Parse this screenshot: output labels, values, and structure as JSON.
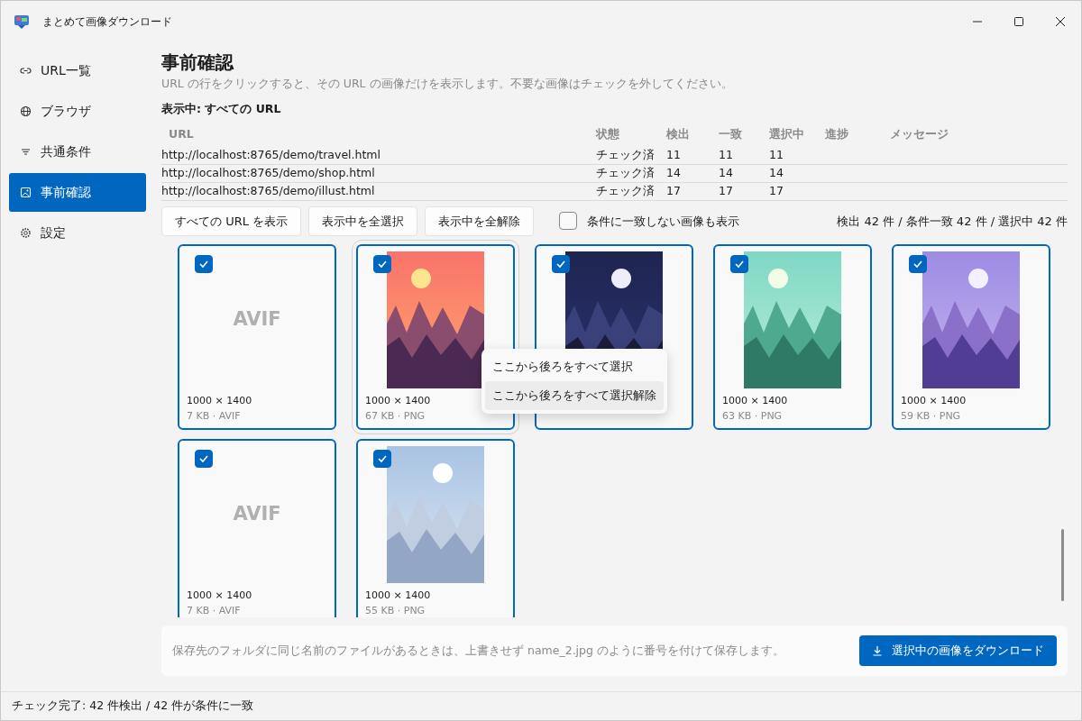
{
  "window": {
    "title": "まとめて画像ダウンロード"
  },
  "sidebar": {
    "items": [
      {
        "label": "URL一覧",
        "selected": false
      },
      {
        "label": "ブラウザ",
        "selected": false
      },
      {
        "label": "共通条件",
        "selected": false
      },
      {
        "label": "事前確認",
        "selected": true
      },
      {
        "label": "設定",
        "selected": false
      }
    ]
  },
  "page": {
    "title": "事前確認",
    "description": "URL の行をクリックすると、その URL の画像だけを表示します。不要な画像はチェックを外してください。",
    "showing": "表示中: すべての URL"
  },
  "table": {
    "columns": [
      "URL",
      "状態",
      "検出",
      "一致",
      "選択中",
      "進捗",
      "メッセージ"
    ],
    "rows": [
      {
        "cells": [
          "http://localhost:8765/demo/travel.html",
          "チェック済",
          "11",
          "11",
          "11"
        ]
      },
      {
        "cells": [
          "http://localhost:8765/demo/shop.html",
          "チェック済",
          "14",
          "14",
          "14"
        ]
      },
      {
        "cells": [
          "http://localhost:8765/demo/illust.html",
          "チェック済",
          "17",
          "17",
          "17"
        ]
      }
    ]
  },
  "toolbar": {
    "buttons": [
      "すべての URL を表示",
      "表示中を全選択",
      "表示中を全解除"
    ],
    "show_unmatched": {
      "label": "条件に一致しない画像も表示",
      "checked": false
    },
    "summary": "検出 42 件 / 条件一致 42 件 / 選択中 42 件"
  },
  "cards": [
    {
      "kind": "placeholder",
      "preview": "AVIF",
      "checked": true,
      "hovered": false,
      "dimensions": "1000 × 1400",
      "size": "7 KB · AVIF"
    },
    {
      "kind": "picture",
      "checked": true,
      "hovered": true,
      "dimensions": "1000 × 1400",
      "size": "67 KB · PNG"
    },
    {
      "kind": "picture",
      "checked": true,
      "hovered": false
    },
    {
      "kind": "picture",
      "checked": true,
      "hovered": false,
      "dimensions": "1000 × 1400",
      "size": "63 KB · PNG"
    },
    {
      "kind": "picture",
      "checked": true,
      "hovered": false,
      "dimensions": "1000 × 1400",
      "size": "59 KB · PNG"
    },
    {
      "kind": "placeholder",
      "preview": "AVIF",
      "checked": true,
      "hovered": false,
      "dimensions": "1000 × 1400",
      "size": "7 KB · AVIF"
    },
    {
      "kind": "picture",
      "checked": true,
      "hovered": false,
      "dimensions": "1000 × 1400",
      "size": "55 KB · PNG"
    }
  ],
  "context_menu": {
    "items": [
      {
        "label": "ここから後ろをすべて選択",
        "highlighted": false
      },
      {
        "label": "ここから後ろをすべて選択解除",
        "highlighted": true
      }
    ]
  },
  "footer": {
    "note": "保存先のフォルダに同じ名前のファイルがあるときは、上書きせず name_2.jpg のように番号を付けて保存します。",
    "download_button": "選択中の画像をダウンロード"
  },
  "status_bar": "チェック完了: 42 件検出 / 42 件が条件に一致"
}
